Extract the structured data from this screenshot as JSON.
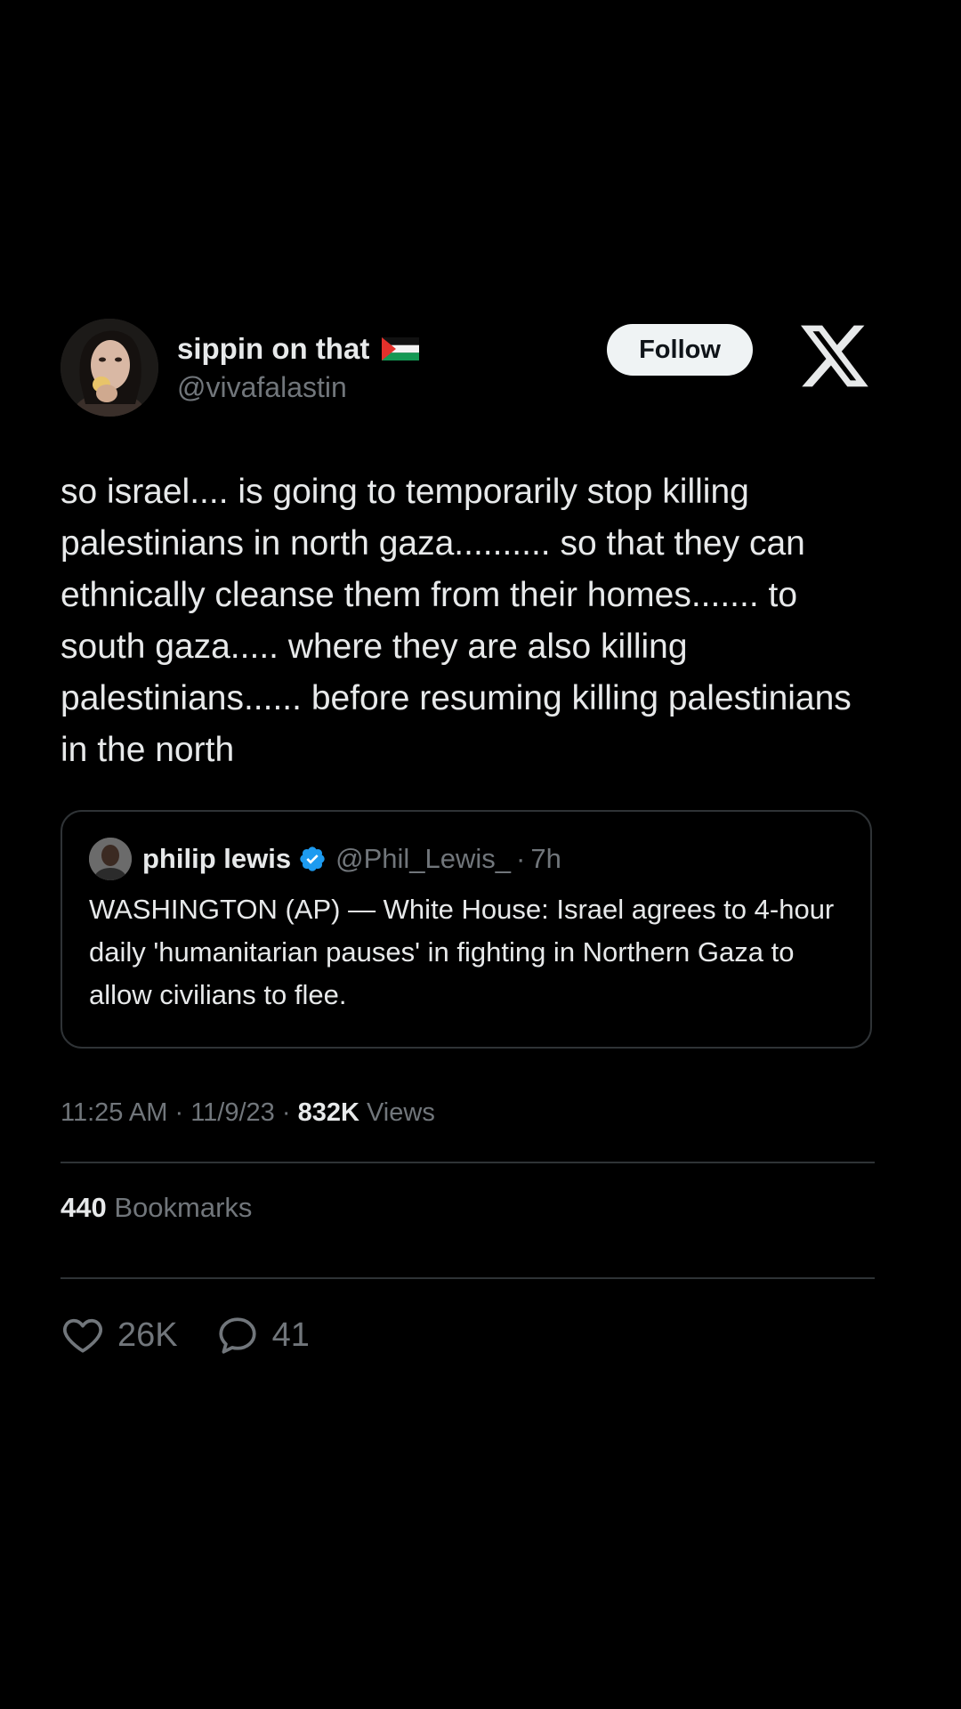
{
  "author": {
    "display_name": "sippin on that",
    "handle": "@vivafalastin",
    "flag_icon": "palestine-flag-icon"
  },
  "header": {
    "follow_label": "Follow",
    "logo_icon": "x-logo-icon"
  },
  "tweet": {
    "text": "so israel.... is going to temporarily stop killing palestinians in north gaza.......... so that they can ethnically cleanse them from their homes....... to south gaza..... where they are also killing palestinians...... before resuming killing palestinians in the north"
  },
  "quote": {
    "name": "philip lewis",
    "handle": "@Phil_Lewis_",
    "dot": "·",
    "time": "7h",
    "verified_icon": "verified-badge-icon",
    "verified_color": "#1d9bf0",
    "text": "WASHINGTON (AP) — White House: Israel agrees to 4-hour daily 'humanitarian pauses' in fighting in Northern Gaza to allow civilians to flee."
  },
  "meta": {
    "time": "11:25 AM",
    "sep1": "·",
    "date": "11/9/23",
    "sep2": "·",
    "views_count": "832K",
    "views_label": "Views"
  },
  "bookmarks": {
    "count": "440",
    "label": "Bookmarks"
  },
  "actions": {
    "likes": "26K",
    "replies": "41"
  },
  "colors": {
    "background": "#000000",
    "text_primary": "#e7e9ea",
    "text_secondary": "#71767b",
    "border": "#2f3336",
    "follow_bg": "#eff3f4"
  }
}
